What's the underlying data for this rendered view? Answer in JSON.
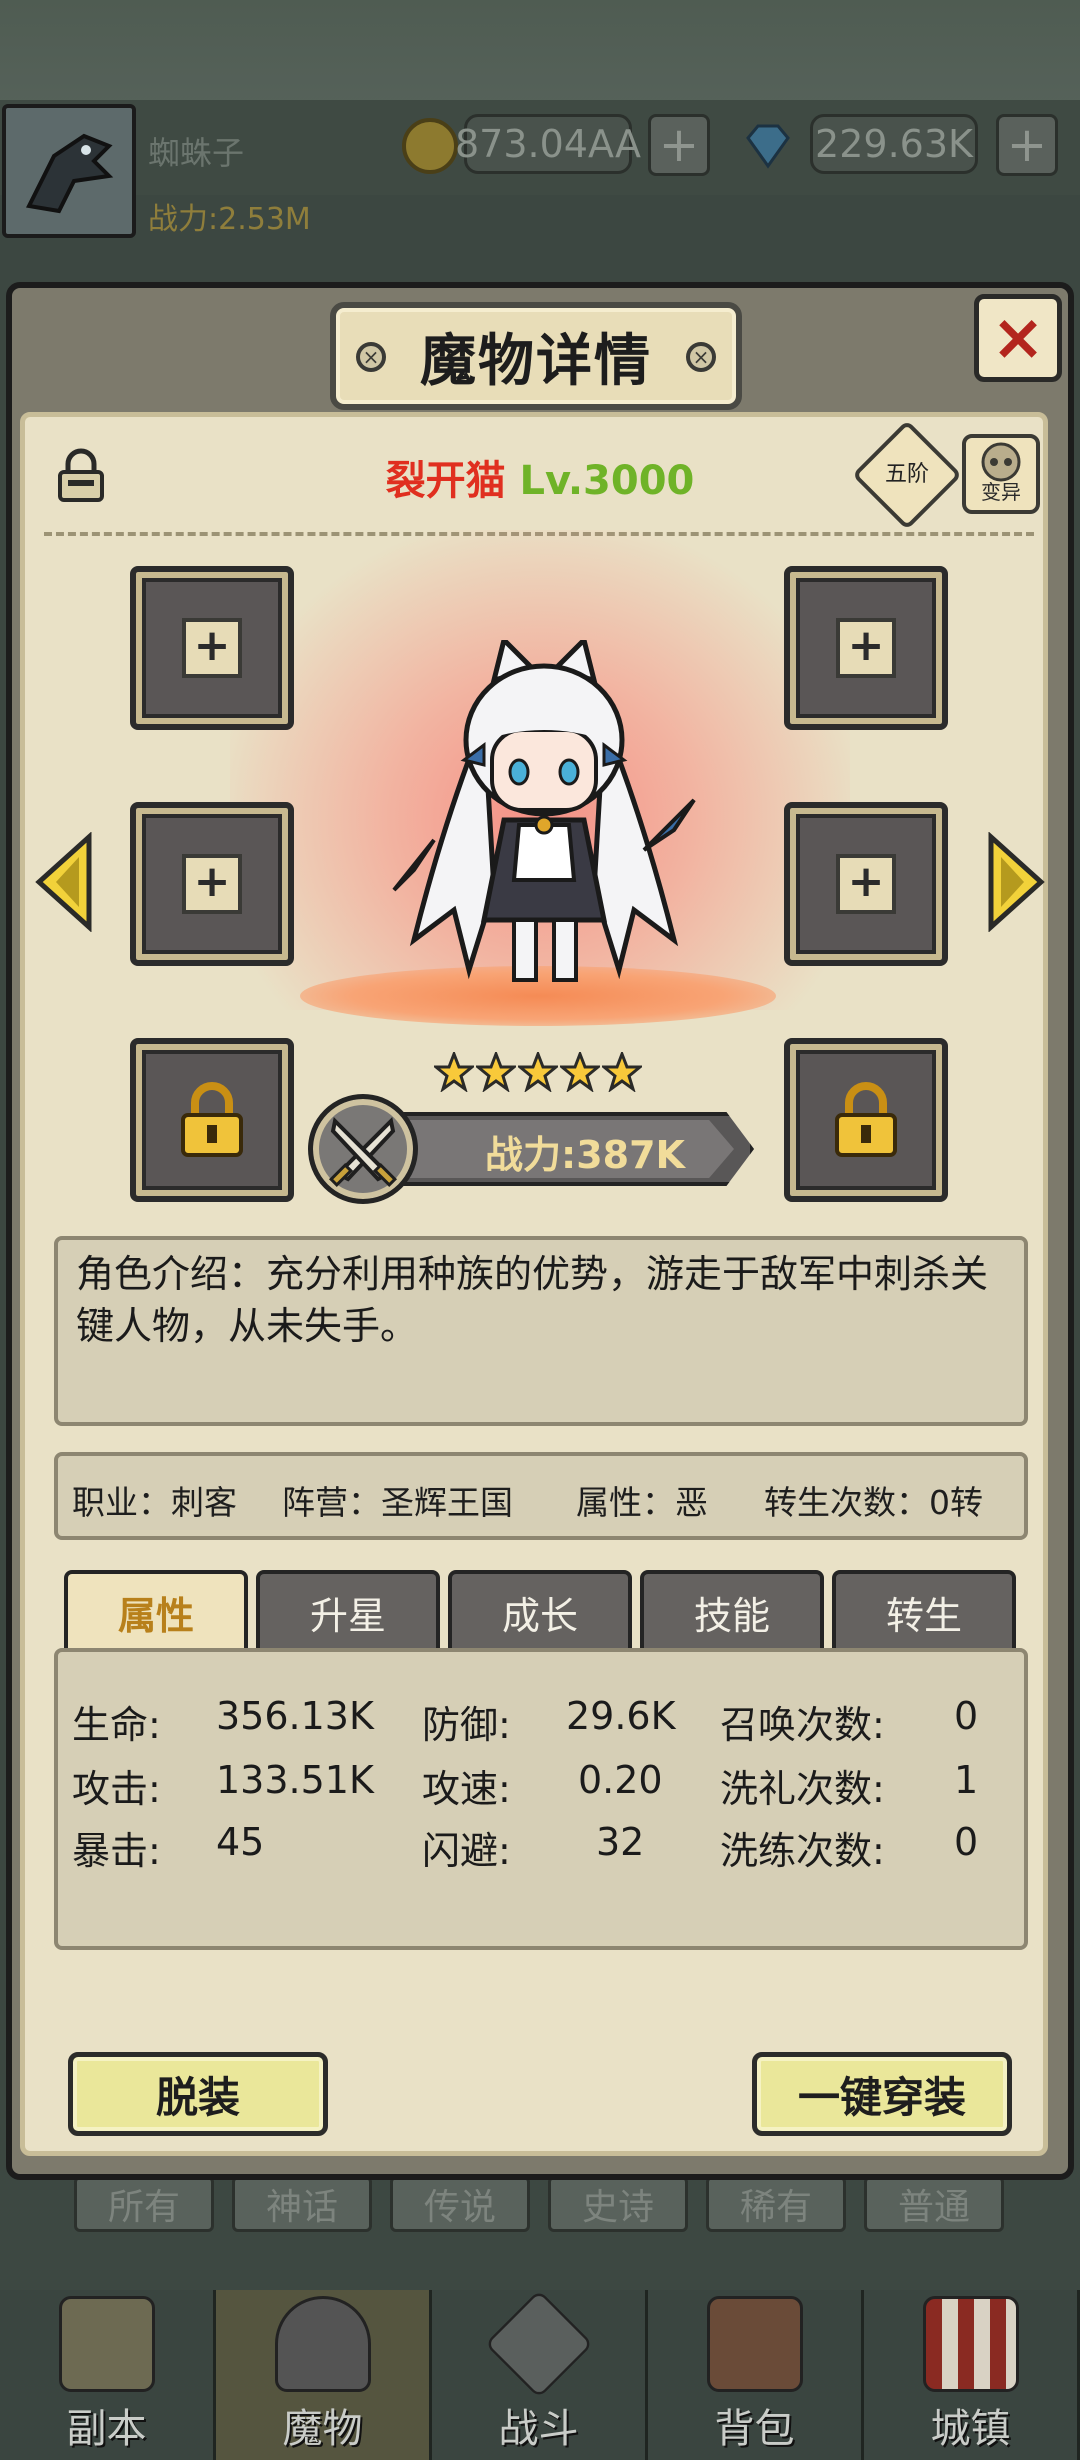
{
  "header": {
    "player_name": "蜘蛛子",
    "player_power": "战力:2.53M",
    "gold": "873.04AA",
    "gems": "229.63K",
    "plus": "+"
  },
  "dialog": {
    "title": "魔物详情",
    "close": "×",
    "monster_name": "裂开猫",
    "monster_level": "Lv.3000",
    "rank": "五阶",
    "mutate": "变异",
    "stars": 5,
    "power": "战力:387K",
    "intro": "角色介绍：充分利用种族的优势，游走于敌军中刺杀关键人物，从未失手。",
    "info": {
      "job": "职业：刺客",
      "camp": "阵营：圣辉王国",
      "attribute": "属性：恶",
      "rebirth": "转生次数：0转"
    },
    "tabs": [
      "属性",
      "升星",
      "成长",
      "技能",
      "转生"
    ],
    "active_tab": "属性",
    "stats": [
      {
        "label": "生命:",
        "value": "356.13K"
      },
      {
        "label": "防御:",
        "value": "29.6K"
      },
      {
        "label": "召唤次数:",
        "value": "0"
      },
      {
        "label": "攻击:",
        "value": "133.51K"
      },
      {
        "label": "攻速:",
        "value": "0.20"
      },
      {
        "label": "洗礼次数:",
        "value": "1"
      },
      {
        "label": "暴击:",
        "value": "45"
      },
      {
        "label": "闪避:",
        "value": "32"
      },
      {
        "label": "洗练次数:",
        "value": "0"
      }
    ],
    "unequip": "脱装",
    "equip_all": "一键穿装"
  },
  "background_tabs": [
    "所有",
    "神话",
    "传说",
    "史诗",
    "稀有",
    "普通"
  ],
  "nav": [
    "副本",
    "魔物",
    "战斗",
    "背包",
    "城镇"
  ],
  "nav_active": "魔物",
  "colors": {
    "name_red": "#e02f1f",
    "level_green": "#6fb328",
    "power_gold": "#f1dc9a",
    "tab_active_text": "#b8801b",
    "button_yellow": "#eae79a"
  },
  "icons": [
    "lock-icon",
    "gold-coin-icon",
    "diamond-icon",
    "swords-icon",
    "star-icon",
    "arrow-left-icon",
    "arrow-right-icon"
  ]
}
